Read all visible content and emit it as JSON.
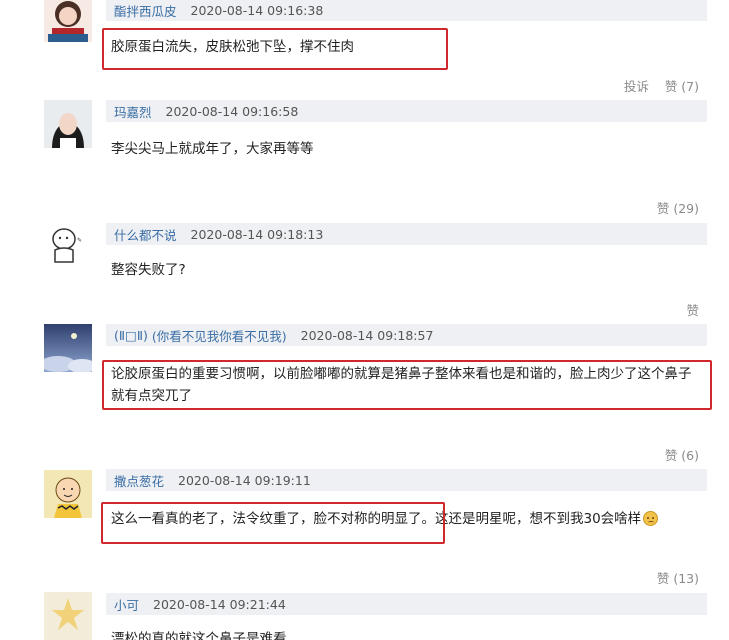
{
  "comments": [
    {
      "user": "酯拌西瓜皮",
      "time": "2020-08-14 09:16:38",
      "text": "胶原蛋白流失，皮肤松弛下坠，撑不住肉",
      "report": "投诉",
      "like": "赞 (7)"
    },
    {
      "user": "玛嘉烈",
      "time": "2020-08-14 09:16:58",
      "text": "李尖尖马上就成年了，大家再等等",
      "like": "赞 (29)"
    },
    {
      "user": "什么都不说",
      "time": "2020-08-14 09:18:13",
      "text": "整容失败了?",
      "like": "赞"
    },
    {
      "user": "(Ⅱ□Ⅱ)",
      "subtitle": "(你看不见我你看不见我)",
      "time": "2020-08-14 09:18:57",
      "text_line1": "论胶原蛋白的重要习惯啊，以前脸嘟嘟的就算是猪鼻子整体来看也是和谐的，脸上肉少了这个鼻子",
      "text_line2": "就有点突兀了",
      "like": "赞 (6)"
    },
    {
      "user": "撒点葱花",
      "time": "2020-08-14 09:19:11",
      "text": "这么一看真的老了，法令纹重了，脸不对称的明显了。这还是明星呢，想不到我30会啥样",
      "like": "赞 (13)"
    },
    {
      "user": "小可",
      "time": "2020-08-14 09:21:44",
      "text": "漂松的真的就这个鼻子是难看"
    }
  ],
  "colors": {
    "highlight": "#d0292d",
    "username": "#3a6ea5",
    "meta_bg": "#eef0f3"
  }
}
